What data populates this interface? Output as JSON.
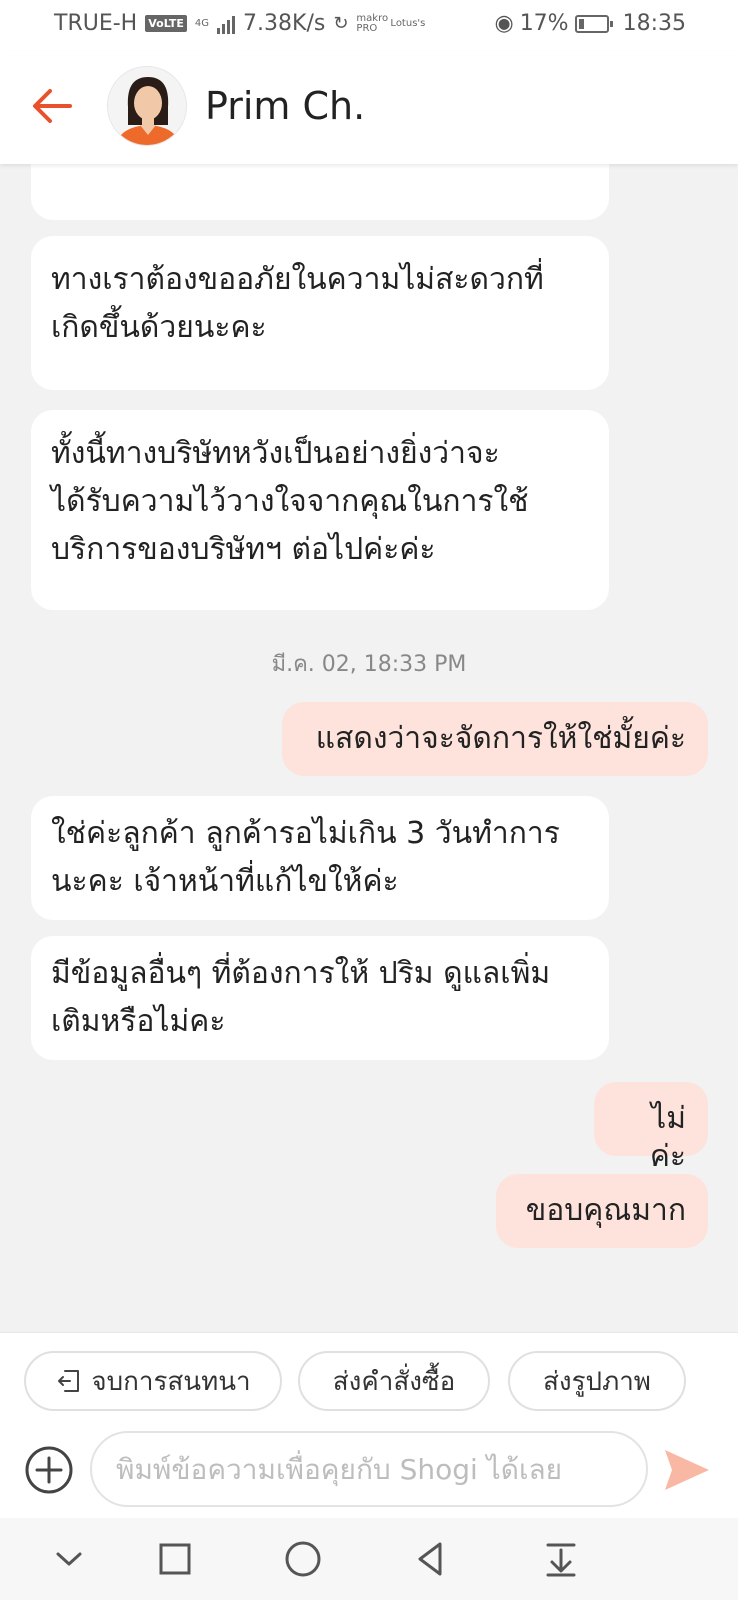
{
  "status_bar": {
    "carrier": "TRUE-H",
    "volte": "VoLTE",
    "network": "4G",
    "speed": "7.38K/s",
    "mini_tag_1": "makro PRO",
    "mini_tag_2": "Lotus's",
    "battery_percent": "17%",
    "battery_level": 0.17,
    "time": "18:35"
  },
  "header": {
    "contact_name": "Prim Ch.",
    "accent_color": "#e8512b"
  },
  "messages": {
    "m1": "ทางเราต้องขออภัยในความไม่สะดวกที่\nเกิดขึ้นด้วยนะคะ",
    "m2": "ทั้งนี้ทางบริษัทหวังเป็นอย่างยิ่งว่าจะ\nได้รับความไว้วางใจจากคุณในการใช้\nบริการของบริษัทฯ ต่อไปค่ะค่ะ",
    "timestamp": "มี.ค. 02, 18:33 PM",
    "m3": "แสดงว่าจะจัดการให้ใช่มั้ยค่ะ",
    "m4": "ใช่ค่ะลูกค้า ลูกค้ารอไม่เกิน 3 วันทำการ\nนะคะ เจ้าหน้าที่แก้ไขให้ค่ะ",
    "m5": "มีข้อมูลอื่นๆ ที่ต้องการให้ ปริม ดูแลเพิ่ม\nเติมหรือไม่คะ",
    "m6": "ไม่ค่ะ",
    "m7": "ขอบคุณมาก"
  },
  "quick_replies": {
    "end_chat": "จบการสนทนา",
    "send_order": "ส่งคำสั่งซื้อ",
    "send_image": "ส่งรูปภาพ"
  },
  "composer": {
    "placeholder": "พิมพ์ข้อความเพื่อคุยกับ Shogi ได้เลย"
  },
  "icons": {
    "back": "arrow-left-icon",
    "add": "plus-circle-icon",
    "send": "send-icon",
    "end_chat": "exit-icon"
  }
}
